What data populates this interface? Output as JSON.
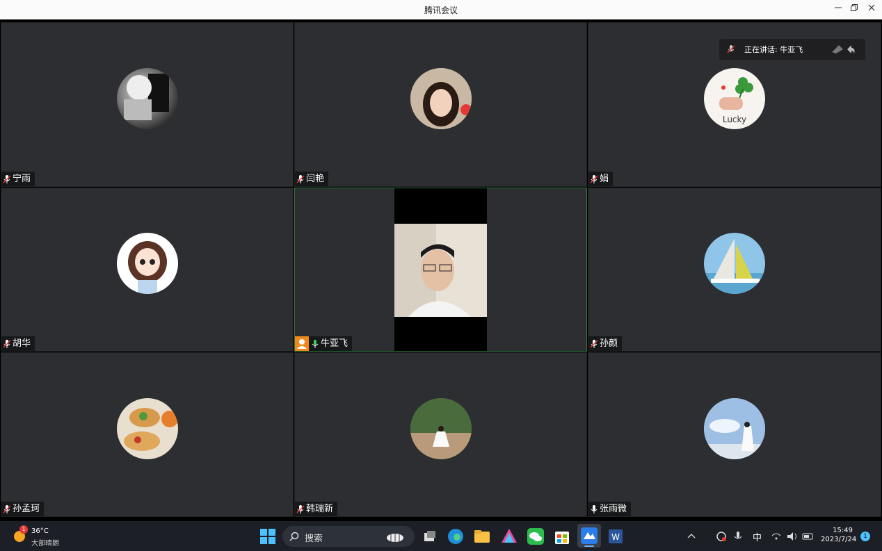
{
  "window": {
    "title": "腾讯会议"
  },
  "speaking": {
    "label": "正在讲话: 牛亚飞"
  },
  "participants": [
    {
      "name": "宁雨"
    },
    {
      "name": "闫艳"
    },
    {
      "name": "娟"
    },
    {
      "name": "胡华"
    },
    {
      "name": "牛亚飞"
    },
    {
      "name": "孙颜"
    },
    {
      "name": "孙孟珂"
    },
    {
      "name": "韩瑞新"
    },
    {
      "name": "张雨微"
    }
  ],
  "taskbar": {
    "weather_temp": "36°C",
    "weather_desc": "大部晴朗",
    "weather_badge": "1",
    "search_label": "搜索",
    "ime": "中",
    "time": "15:49",
    "date": "2023/7/24",
    "notification_count": "1"
  },
  "colors": {
    "tile_bg": "#2d2e31",
    "active_border": "#2c7a3d",
    "taskbar_bg": "#1c1f26",
    "accent_orange": "#f0891a"
  }
}
